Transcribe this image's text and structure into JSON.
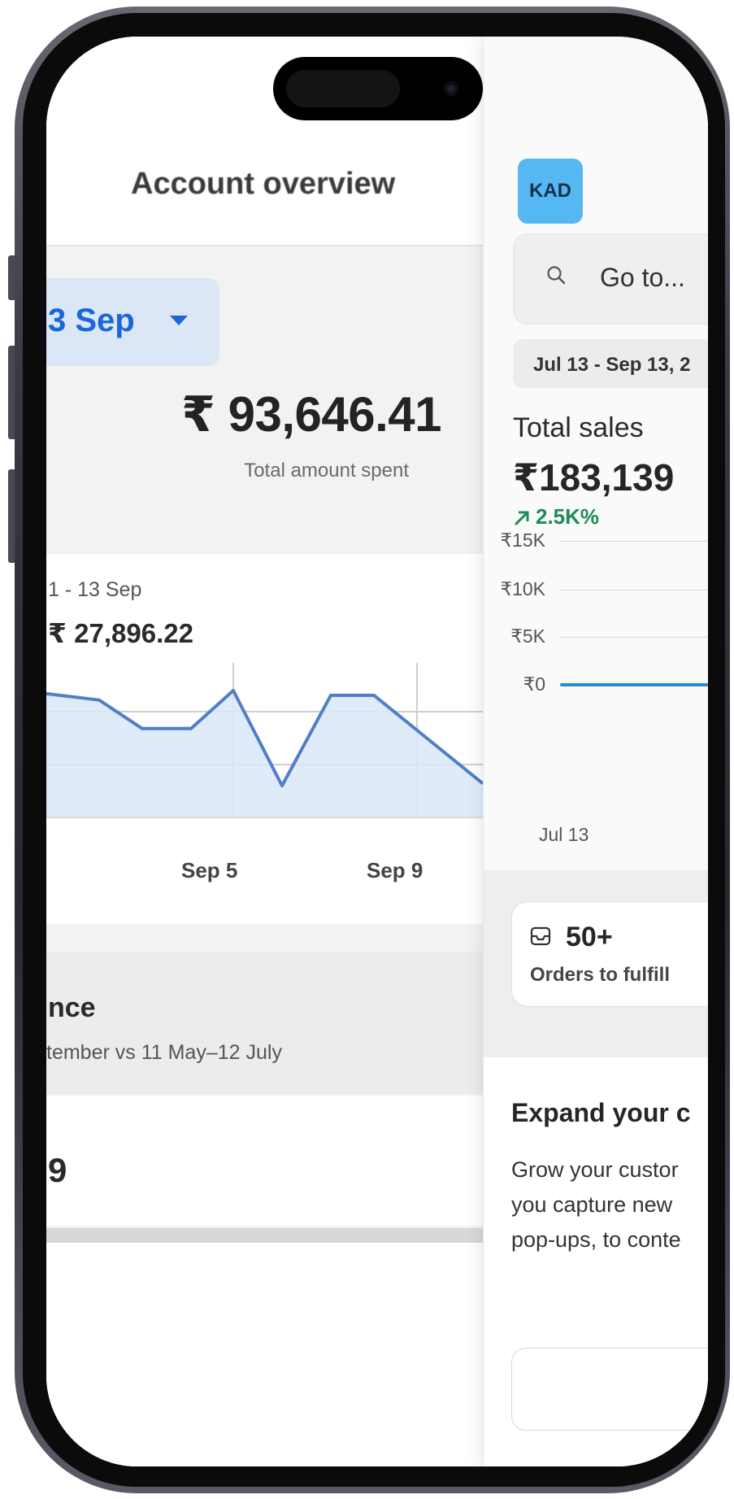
{
  "left_panel": {
    "title": "Account overview",
    "date_pill": "3 Sep",
    "total_amount": "₹ 93,646.41",
    "total_amount_caption": "Total amount spent",
    "chart": {
      "range_label": "1 - 13 Sep",
      "total": "₹ 27,896.22",
      "x_ticks": [
        "Sep 5",
        "Sep 9"
      ]
    },
    "performance": {
      "title": "nce",
      "subtitle": "tember vs 11 May–12 July"
    },
    "stat_value": "9"
  },
  "right_panel": {
    "avatar": "KAD",
    "search_placeholder": "Go to...",
    "date_range": "Jul 13 - Sep 13, 2",
    "total_sales_label": "Total sales",
    "total_sales_value": "₹183,139",
    "total_sales_change": "2.5K%",
    "y_ticks": [
      "₹15K",
      "₹10K",
      "₹5K",
      "₹0"
    ],
    "x_tick": "Jul 13",
    "orders_count": "50+",
    "orders_label": "Orders to fulfill",
    "expand_title": "Expand your c",
    "expand_body": "Grow your custor\nyou capture new\npop-ups, to conte"
  },
  "chart_data": {
    "type": "area",
    "color": "#4f7fc4",
    "fill": "#dbe8f8",
    "values": [
      0.78,
      0.74,
      0.56,
      0.56,
      0.8,
      0.2,
      0.77,
      0.77,
      0.55
    ]
  },
  "colors": {
    "meta_blue": "#1c67d8",
    "shopify_green": "#1f8b58",
    "avatar_bg": "#56b8f2"
  }
}
